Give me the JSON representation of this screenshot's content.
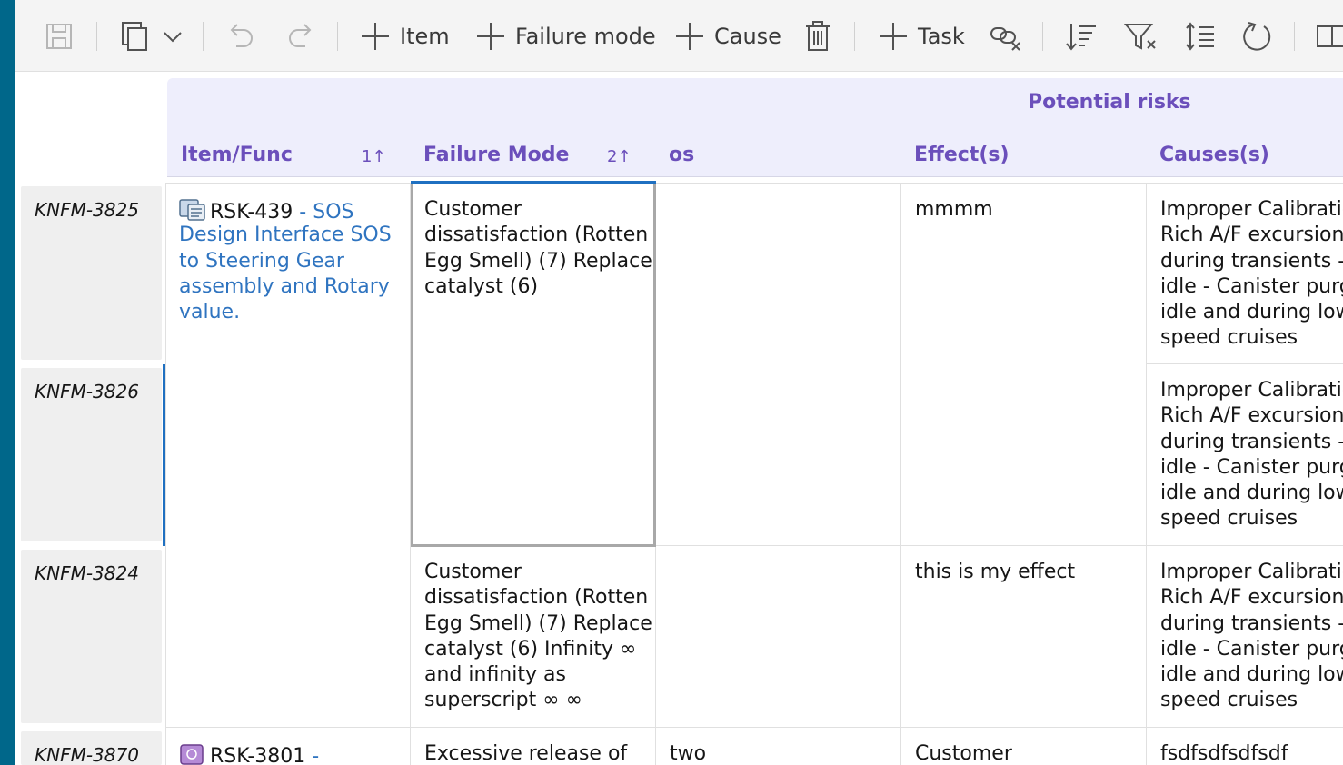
{
  "toolbar": {
    "item_label": "Item",
    "failure_mode_label": "Failure mode",
    "cause_label": "Cause",
    "task_label": "Task"
  },
  "header": {
    "group_title": "Potential risks",
    "columns": [
      {
        "label": "Item/Func",
        "sort": "1↑"
      },
      {
        "label": "Failure Mode",
        "sort": "2↑"
      },
      {
        "label": "os",
        "sort": ""
      },
      {
        "label": "Effect(s)",
        "sort": ""
      },
      {
        "label": "Causes(s)",
        "sort": ""
      }
    ]
  },
  "rows": [
    {
      "id": "KNFM-3825"
    },
    {
      "id": "KNFM-3826"
    },
    {
      "id": "KNFM-3824"
    },
    {
      "id": "KNFM-3870"
    }
  ],
  "items": [
    {
      "id": "RSK-439",
      "title_lines": [
        " - SOS",
        "Design Interface SOS",
        "to Steering Gear",
        "assembly and Rotary",
        "value."
      ]
    },
    {
      "id": "RSK-3801",
      "title_lines": [
        " -"
      ]
    }
  ],
  "failure_modes": [
    {
      "lines": [
        "Customer",
        "dissatisfaction (Rotten",
        "Egg Smell) (7) Replace",
        "catalyst (6)"
      ]
    },
    {
      "lines": [
        "Customer",
        "dissatisfaction (Rotten",
        "Egg Smell) (7) Replace",
        "catalyst (6) Infinity ∞",
        "and infinity as",
        "superscript ∞ ∞"
      ]
    },
    {
      "lines": [
        "Excessive release of"
      ]
    }
  ],
  "os_values": [
    "two"
  ],
  "effects": [
    {
      "lines": [
        "mmmm"
      ]
    },
    {
      "lines": [
        "this is my effect"
      ]
    },
    {
      "lines": [
        "Customer"
      ]
    }
  ],
  "causes": [
    {
      "lines": [
        "Improper Calibratio",
        "Rich A/F excursions",
        "during transients - a",
        "idle - Canister purge",
        "idle and during low",
        "speed cruises"
      ]
    },
    {
      "lines": [
        "Improper Calibratio",
        "Rich A/F excursions",
        "during transients - a",
        "idle - Canister purge",
        "idle and during low",
        "speed cruises"
      ]
    },
    {
      "lines": [
        "Improper Calibratio",
        "Rich A/F excursions",
        "during transients - a",
        "idle - Canister purge",
        "idle and during low",
        "speed cruises"
      ]
    },
    {
      "lines": [
        "fsdfsdfsdfsdf"
      ]
    }
  ],
  "colors": {
    "accent": "#6b4fbb",
    "link": "#2f74c0",
    "rail": "#00678a",
    "selection": "#1f70c1"
  }
}
